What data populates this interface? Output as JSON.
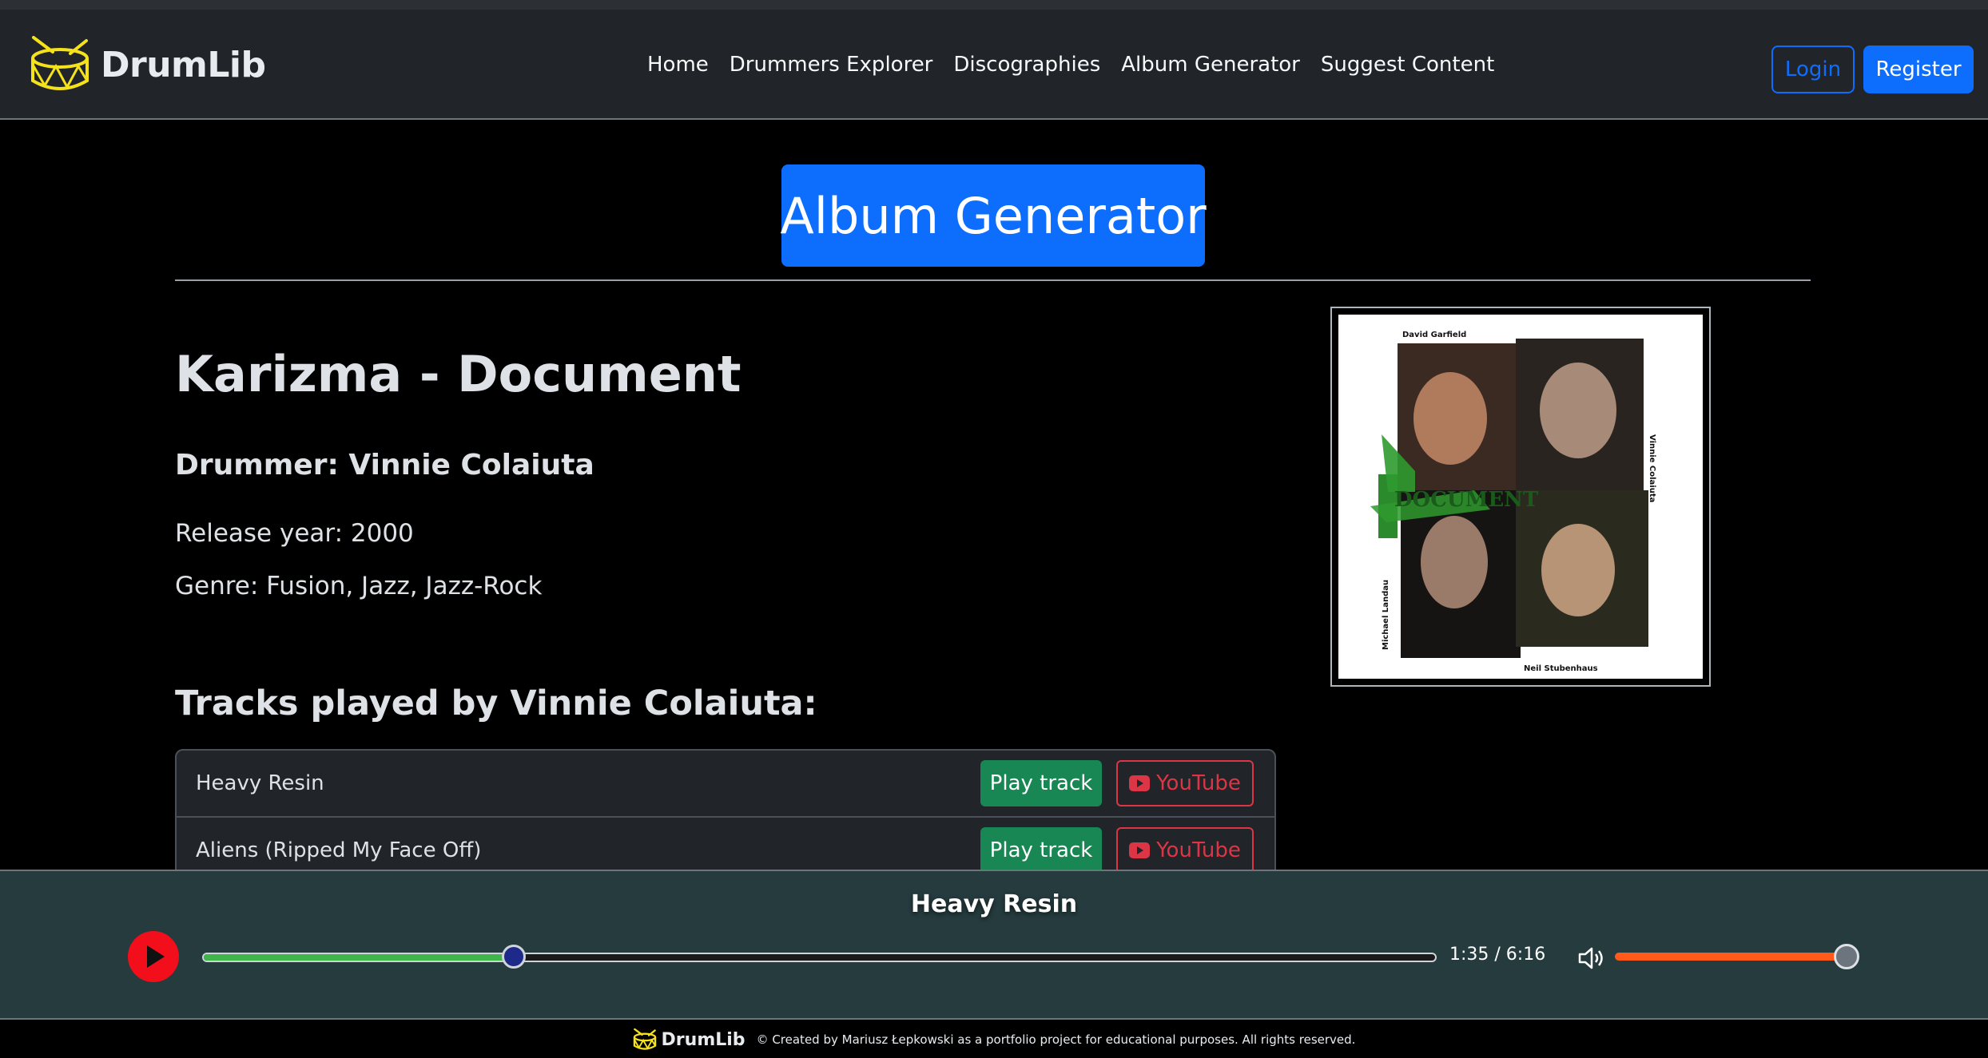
{
  "brand": {
    "name": "DrumLib",
    "logo": "drum-icon",
    "logo_color": "#f5e21b"
  },
  "nav": {
    "links": [
      "Home",
      "Drummers Explorer",
      "Discographies",
      "Album Generator",
      "Suggest Content"
    ],
    "login_label": "Login",
    "register_label": "Register"
  },
  "page": {
    "heading": "Album Generator"
  },
  "album": {
    "title": "Karizma - Document",
    "drummer_line": "Drummer: Vinnie Colaiuta",
    "release_line": "Release year: 2000",
    "genre_line": "Genre: Fusion, Jazz, Jazz-Rock",
    "cover_names": [
      "David Garfield",
      "Vinnie Colaiuta",
      "Michael Landau",
      "Neil Stubenhaus"
    ]
  },
  "tracks": {
    "heading": "Tracks played by Vinnie Colaiuta:",
    "play_label": "Play track",
    "youtube_label": "YouTube",
    "items": [
      "Heavy Resin",
      "Aliens (Ripped My Face Off)"
    ]
  },
  "player": {
    "now_playing": "Heavy Resin",
    "time_text": "1:35 / 6:16",
    "progress_fraction": 0.2527,
    "volume_fraction": 1.0,
    "colors": {
      "progress": "#3fb54a",
      "volume": "#ff5a1a",
      "play": "#f20e1a"
    }
  },
  "footer": {
    "brand": "DrumLib",
    "text": "© Created by Mariusz Łepkowski as a portfolio project for educational purposes. All rights reserved."
  }
}
